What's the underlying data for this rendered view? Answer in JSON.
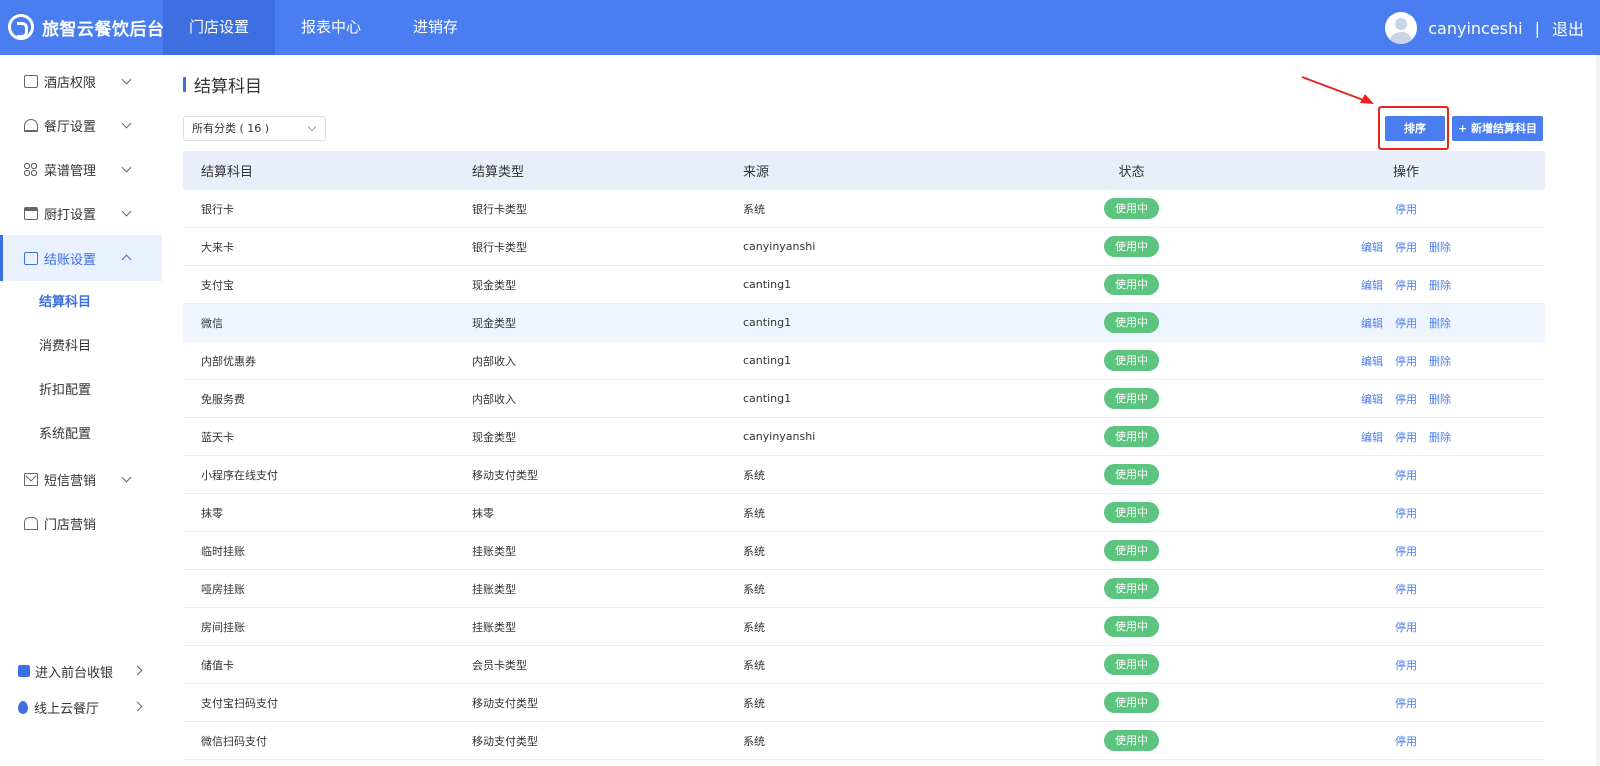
{
  "app": {
    "brand": "旅智云餐饮后台"
  },
  "nav": [
    {
      "label": "门店设置",
      "active": true
    },
    {
      "label": "报表中心",
      "active": false
    },
    {
      "label": "进销存",
      "active": false
    }
  ],
  "user": {
    "name": "canyinceshi",
    "separator": "|",
    "logout": "退出"
  },
  "sidebar": {
    "items": [
      {
        "label": "酒店权限",
        "icon": "hotel-icon"
      },
      {
        "label": "餐厅设置",
        "icon": "bell-icon"
      },
      {
        "label": "菜谱管理",
        "icon": "grid-icon"
      },
      {
        "label": "厨打设置",
        "icon": "printer-icon"
      },
      {
        "label": "结账设置",
        "icon": "bill-icon",
        "active": true
      },
      {
        "label": "短信营销",
        "icon": "mail-icon"
      },
      {
        "label": "门店营销",
        "icon": "shop-icon"
      }
    ],
    "subitems": [
      {
        "label": "结算科目",
        "active": true
      },
      {
        "label": "消费科目"
      },
      {
        "label": "折扣配置"
      },
      {
        "label": "系统配置"
      }
    ],
    "bottom": [
      {
        "label": "进入前台收银"
      },
      {
        "label": "线上云餐厅"
      }
    ]
  },
  "page": {
    "title": "结算科目",
    "filter": "所有分类 ( 16 )",
    "sort_button": "排序",
    "add_button": "+ 新增结算科目"
  },
  "table": {
    "headers": [
      "结算科目",
      "结算类型",
      "来源",
      "状态",
      "操作"
    ],
    "ops": {
      "edit": "编辑",
      "disable": "停用",
      "delete": "删除"
    },
    "rows": [
      {
        "name": "银行卡",
        "type": "银行卡类型",
        "source": "系统",
        "status": "使用中",
        "editable": false
      },
      {
        "name": "大来卡",
        "type": "银行卡类型",
        "source": "canyinyanshi",
        "status": "使用中",
        "editable": true
      },
      {
        "name": "支付宝",
        "type": "现金类型",
        "source": "canting1",
        "status": "使用中",
        "editable": true
      },
      {
        "name": "微信",
        "type": "现金类型",
        "source": "canting1",
        "status": "使用中",
        "editable": true
      },
      {
        "name": "内部优惠券",
        "type": "内部收入",
        "source": "canting1",
        "status": "使用中",
        "editable": true
      },
      {
        "name": "免服务费",
        "type": "内部收入",
        "source": "canting1",
        "status": "使用中",
        "editable": true
      },
      {
        "name": "蓝天卡",
        "type": "现金类型",
        "source": "canyinyanshi",
        "status": "使用中",
        "editable": true
      },
      {
        "name": "小程序在线支付",
        "type": "移动支付类型",
        "source": "系统",
        "status": "使用中",
        "editable": false
      },
      {
        "name": "抹零",
        "type": "抹零",
        "source": "系统",
        "status": "使用中",
        "editable": false
      },
      {
        "name": "临时挂账",
        "type": "挂账类型",
        "source": "系统",
        "status": "使用中",
        "editable": false
      },
      {
        "name": "哑房挂账",
        "type": "挂账类型",
        "source": "系统",
        "status": "使用中",
        "editable": false
      },
      {
        "name": "房间挂账",
        "type": "挂账类型",
        "source": "系统",
        "status": "使用中",
        "editable": false
      },
      {
        "name": "储值卡",
        "type": "会员卡类型",
        "source": "系统",
        "status": "使用中",
        "editable": false
      },
      {
        "name": "支付宝扫码支付",
        "type": "移动支付类型",
        "source": "系统",
        "status": "使用中",
        "editable": false
      },
      {
        "name": "微信扫码支付",
        "type": "移动支付类型",
        "source": "系统",
        "status": "使用中",
        "editable": false
      }
    ]
  },
  "colors": {
    "primary": "#4a7ef0",
    "status_green": "#5cc47e",
    "highlight": "#e8241c"
  }
}
